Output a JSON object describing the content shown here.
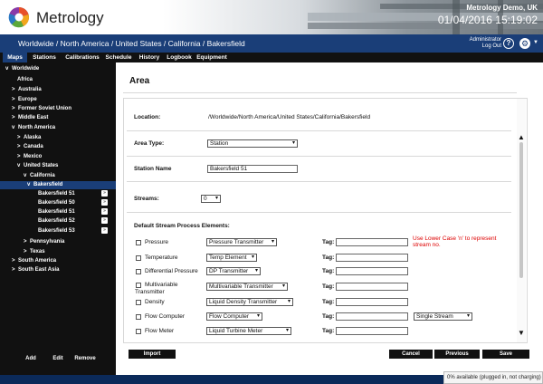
{
  "header": {
    "brand": "Metrology",
    "company": "Metrology Demo, UK",
    "datetime": "01/04/2016  15:19:02",
    "colors": {
      "accent": "#1a3e78",
      "nav": "#111111"
    }
  },
  "breadcrumb": {
    "path": "Worldwide / North America / United States / California / Bakersfield",
    "user": "Administrator",
    "logout": "Log Out",
    "help_glyph": "?",
    "settings_glyph": "⚙",
    "caret_glyph": "▼"
  },
  "nav": {
    "tabs": [
      "Maps",
      "Stations",
      "Calibrations",
      "Schedule",
      "History",
      "Logbook",
      "Equipment"
    ]
  },
  "tree": {
    "nodes": [
      {
        "label": "Worldwide",
        "chevron": "v"
      },
      {
        "label": "Africa",
        "chevron": ""
      },
      {
        "label": "Australia",
        "chevron": ">"
      },
      {
        "label": "Europe",
        "chevron": ">"
      },
      {
        "label": "Former Soviet Union",
        "chevron": ">"
      },
      {
        "label": "Middle East",
        "chevron": ">"
      },
      {
        "label": "North America",
        "chevron": "v"
      },
      {
        "label": "Alaska",
        "chevron": ">"
      },
      {
        "label": "Canada",
        "chevron": ">"
      },
      {
        "label": "Mexico",
        "chevron": ">"
      },
      {
        "label": "United States",
        "chevron": "v"
      },
      {
        "label": "California",
        "chevron": "v"
      },
      {
        "label": "Bakersfield",
        "chevron": "v"
      },
      {
        "label": "Pennsylvania",
        "chevron": ">"
      },
      {
        "label": "Texas",
        "chevron": ">"
      },
      {
        "label": "South America",
        "chevron": ">"
      },
      {
        "label": "South East Asia",
        "chevron": ">"
      }
    ],
    "stations": [
      "Bakersfield 51",
      "Bakersfield 50",
      "Bakersfield 51",
      "Bakersfield 52",
      "Bakersfield 53"
    ],
    "leaf_arrow": "»",
    "buttons": [
      "Add",
      "Edit",
      "Remove"
    ]
  },
  "form": {
    "title": "Area",
    "location_label": "Location:",
    "location_value": "/Worldwide/North America/United States/California/Bakersfield",
    "area_type_label": "Area Type:",
    "area_type_value": "Station",
    "station_name_label": "Station Name",
    "station_name_value": "Bakersfield 51",
    "streams_label": "Streams:",
    "streams_value": "0",
    "elements_heading": "Default Stream Process Elements:",
    "tag_label": "Tag:",
    "dropdown_glyph": "▾",
    "note": "Use Lower Case 'n' to represent stream no.",
    "elements": [
      {
        "name": "Pressure",
        "select": "Pressure Transmitter"
      },
      {
        "name": "Temperature",
        "select": "Temp Element"
      },
      {
        "name": "Differential Pressure",
        "select": "DP Transmitter"
      },
      {
        "name": "Multivariable",
        "name2": "Transmitter",
        "select": "Multivariable Transmitter"
      },
      {
        "name": "Density",
        "select": "Liquid Density Transmitter"
      },
      {
        "name": "Flow Computer",
        "select": "Flow Computer",
        "extra": "Single Stream"
      },
      {
        "name": "Flow Meter",
        "select": "Liquid Turbine Meter"
      }
    ],
    "scroll_up": "▲",
    "scroll_down": "▼"
  },
  "actions": {
    "import": "Import",
    "cancel": "Cancel",
    "previous": "Previous",
    "save": "Save"
  },
  "status": {
    "battery": "0% available (plugged in, not charging)"
  }
}
